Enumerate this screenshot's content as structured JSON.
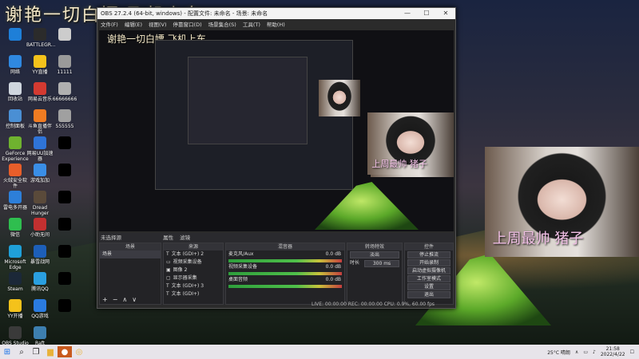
{
  "overlay": {
    "title": "谢艳一切白嫖 飞机上车",
    "small_title": "谢艳一切白嫖 飞机上车"
  },
  "desktop_icons": [
    {
      "label": "",
      "color": "#1e7fd8"
    },
    {
      "label": "BATTLEGR...",
      "color": "#2b2b2b"
    },
    {
      "label": "",
      "color": "#cccccc"
    },
    {
      "label": "网络",
      "color": "#2f88e0"
    },
    {
      "label": "YY直播",
      "color": "#f4c21b"
    },
    {
      "label": "11111",
      "color": "#9a9a9a"
    },
    {
      "label": "回收站",
      "color": "#cfd6de"
    },
    {
      "label": "网易云音乐",
      "color": "#d33a31"
    },
    {
      "label": "66666666",
      "color": "#b0b0b0"
    },
    {
      "label": "控制面板",
      "color": "#4a8fd4"
    },
    {
      "label": "斗鱼直播伴侣",
      "color": "#f07c22"
    },
    {
      "label": "555555",
      "color": "#a0a0a0"
    },
    {
      "label": "GeForce Experience",
      "color": "#6fb22f"
    },
    {
      "label": "网易UU加速器",
      "color": "#2f74d8"
    },
    {
      "label": "",
      "color": "#000000"
    },
    {
      "label": "火绒安全软件",
      "color": "#e85e2a"
    },
    {
      "label": "游戏加加",
      "color": "#3a8ee6"
    },
    {
      "label": "",
      "color": "#000000"
    },
    {
      "label": "雷电多开器",
      "color": "#2d7fd9"
    },
    {
      "label": "Dread Hunger",
      "color": "#5a4a3a"
    },
    {
      "label": "",
      "color": "#000000"
    },
    {
      "label": "微信",
      "color": "#2fbe4f"
    },
    {
      "label": "小助无间",
      "color": "#c23030"
    },
    {
      "label": "",
      "color": "#000000"
    },
    {
      "label": "Microsoft Edge",
      "color": "#1fa0d8"
    },
    {
      "label": "暴雪战网",
      "color": "#1d5fb8"
    },
    {
      "label": "",
      "color": "#000000"
    },
    {
      "label": "Steam",
      "color": "#1b2838"
    },
    {
      "label": "腾讯QQ",
      "color": "#2a9fe0"
    },
    {
      "label": "",
      "color": "#000000"
    },
    {
      "label": "YY开播",
      "color": "#f4c21b"
    },
    {
      "label": "QQ游戏",
      "color": "#2a7be0"
    },
    {
      "label": "",
      "color": "#000000"
    },
    {
      "label": "OBS Studio",
      "color": "#3a3a3a"
    },
    {
      "label": "Raft",
      "color": "#3d7fb0"
    }
  ],
  "obs": {
    "window_title": "OBS 27.2.4 (64-bit, windows) - 配置文件: 未命名 - 场景: 未命名",
    "menu": [
      "文件(F)",
      "编辑(E)",
      "视图(V)",
      "停靠窗口(D)",
      "场景集合(S)",
      "工具(T)",
      "帮助(H)"
    ],
    "active_scene_label": "未选择源",
    "tabs": [
      "属性",
      "滤镜"
    ],
    "panels": {
      "scenes": {
        "title": "场景",
        "items": [
          "场景"
        ]
      },
      "sources": {
        "title": "来源",
        "items": [
          "文本 (GDI+) 2",
          "视频采集设备",
          "图像 2",
          "显示器采集",
          "文本 (GDI+) 3",
          "文本 (GDI+)"
        ]
      },
      "mixer": {
        "title": "混音器",
        "channels": [
          {
            "name": "麦克风/Aux",
            "db": "0.0 dB"
          },
          {
            "name": "视频采集设备",
            "db": "0.0 dB"
          },
          {
            "name": "桌面音频",
            "db": "0.0 dB"
          }
        ]
      },
      "transitions": {
        "title": "转场特效",
        "type": "淡出",
        "duration_label": "时长",
        "duration": "300 ms"
      },
      "controls": {
        "title": "控件",
        "buttons": [
          "停止推流",
          "开始录制",
          "启动虚拟摄像机",
          "工作室模式",
          "设置",
          "退出"
        ]
      }
    },
    "status": "LIVE: 00:00:00    REC: 00:00:00    CPU: 0.9%, 60.00 fps"
  },
  "webcam_caption": "上周最帅 猪子",
  "taskbar": {
    "weather": "25°C 晴朗",
    "time": "21:58",
    "date": "2022/4/22",
    "apps": [
      "windows-start-icon",
      "search-icon",
      "task-view-icon",
      "file-explorer-icon",
      "edge-icon",
      "obs-app-icon",
      "chrome-icon"
    ]
  }
}
